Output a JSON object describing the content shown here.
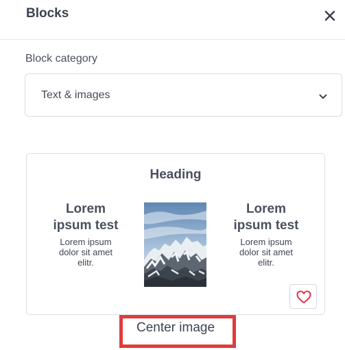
{
  "header": {
    "title": "Blocks",
    "close_icon": "close-icon"
  },
  "category": {
    "label": "Block category",
    "selected": "Text & images",
    "chevron_icon": "chevron-down-icon"
  },
  "block_preview": {
    "heading": "Heading",
    "left": {
      "title": "Lorem ipsum test",
      "body": "Lorem ipsum dolor sit amet elitr."
    },
    "right": {
      "title": "Lorem ipsum test",
      "body": "Lorem ipsum dolor sit amet elitr."
    },
    "image": "mountain-photo",
    "favorite_icon": "heart-icon",
    "caption": "Center image"
  },
  "colors": {
    "highlight": "#e03b3b",
    "heart": "#e5334f"
  }
}
